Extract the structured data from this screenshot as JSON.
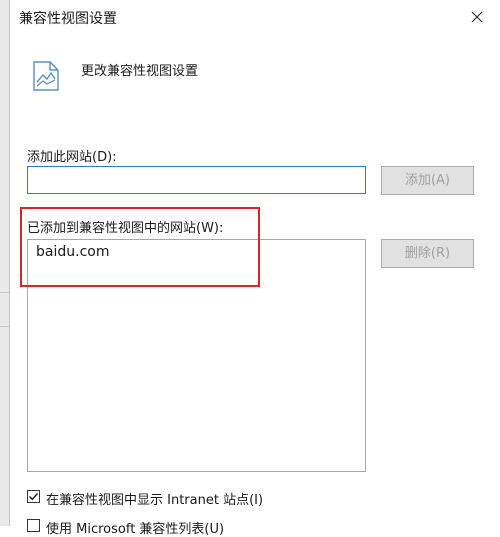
{
  "dialog": {
    "title": "兼容性视图设置",
    "close_icon": "close-icon",
    "header_icon": "compatibility-icon",
    "header_text": "更改兼容性视图设置"
  },
  "add_section": {
    "label": "添加此网站(D):",
    "input_value": "",
    "add_button": "添加(A)"
  },
  "list_section": {
    "label": "已添加到兼容性视图中的网站(W):",
    "items": [
      "baidu.com"
    ],
    "remove_button": "删除(R)"
  },
  "options": {
    "intranet_label": "在兼容性视图中显示 Intranet 站点(I)",
    "intranet_checked": true,
    "microsoft_list_label": "使用 Microsoft 兼容性列表(U)",
    "microsoft_list_checked": false
  },
  "colors": {
    "highlight": "#d6262b",
    "input_border": "#2a7ad6",
    "disabled_text": "#a0a0a0"
  }
}
